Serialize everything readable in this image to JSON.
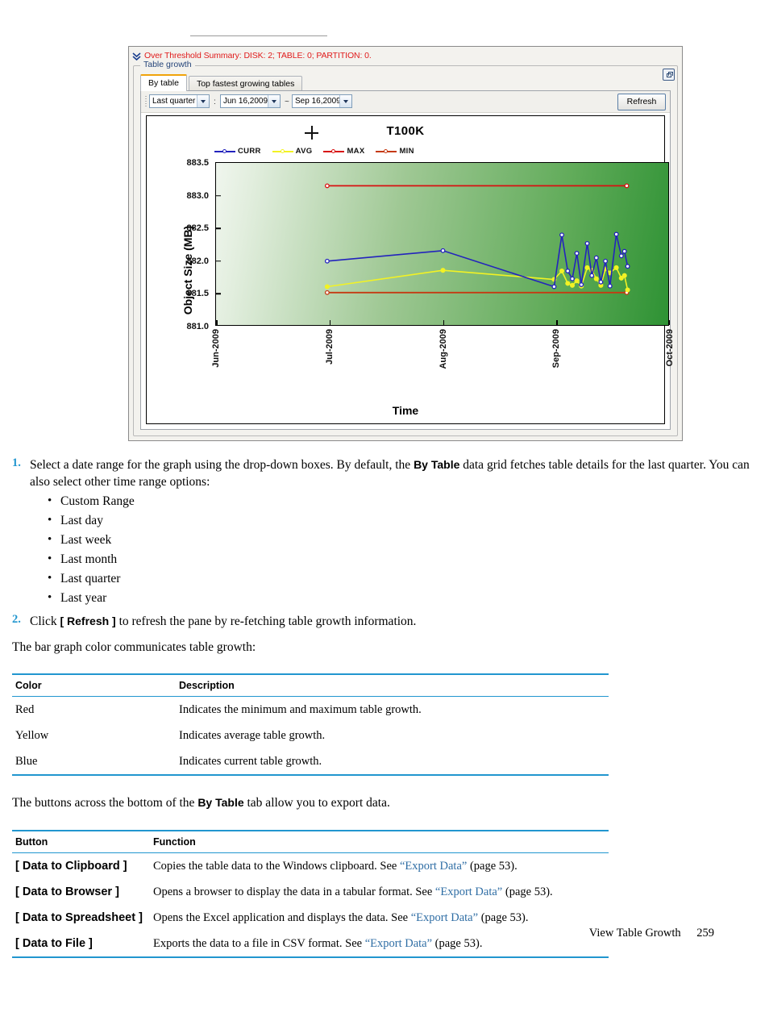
{
  "screenshot": {
    "threshold_summary": "Over Threshold Summary: DISK: 2; TABLE: 0; PARTITION: 0.",
    "group_title": "Table growth",
    "tabs": [
      {
        "label": "By table",
        "active": true
      },
      {
        "label": "Top fastest growing tables",
        "active": false
      }
    ],
    "toolbar": {
      "range_select": "Last quarter",
      "separator_colon": ":",
      "date_from": "Jun 16,2009",
      "separator_tilde": "~",
      "date_to": "Sep 16,2009",
      "refresh_label": "Refresh"
    }
  },
  "chart_data": {
    "type": "line",
    "title": "T100K",
    "xlabel": "Time",
    "ylabel": "Object Size (MB)",
    "ylim": [
      881.0,
      883.5
    ],
    "yticks": [
      "881.0",
      "881.5",
      "882.0",
      "882.5",
      "883.0",
      "883.5"
    ],
    "ytick_values": [
      881.0,
      881.5,
      882.0,
      882.5,
      883.0,
      883.5
    ],
    "xticks": [
      "Jun-2009",
      "Jul-2009",
      "Aug-2009",
      "Sep-2009",
      "Oct-2009"
    ],
    "xtick_positions": [
      0,
      0.25,
      0.5,
      0.75,
      1.0
    ],
    "grid": false,
    "legend_position": "top",
    "colors": {
      "curr": "#2323bd",
      "avg": "#f2f224",
      "max": "#d81111",
      "min": "#c53a12"
    },
    "series": [
      {
        "name": "CURR",
        "color": "#2323bd",
        "points": [
          [
            0.245,
            882.0
          ],
          [
            0.5,
            882.16
          ],
          [
            0.745,
            881.61
          ],
          [
            0.762,
            882.4
          ],
          [
            0.775,
            881.85
          ],
          [
            0.785,
            881.73
          ],
          [
            0.795,
            882.12
          ],
          [
            0.805,
            881.64
          ],
          [
            0.818,
            882.27
          ],
          [
            0.828,
            881.78
          ],
          [
            0.838,
            882.05
          ],
          [
            0.848,
            881.68
          ],
          [
            0.858,
            882.0
          ],
          [
            0.868,
            881.62
          ],
          [
            0.882,
            882.41
          ],
          [
            0.893,
            882.08
          ],
          [
            0.9,
            882.15
          ],
          [
            0.907,
            881.92
          ]
        ]
      },
      {
        "name": "AVG",
        "color": "#f2f224",
        "points": [
          [
            0.245,
            881.61
          ],
          [
            0.5,
            881.86
          ],
          [
            0.745,
            881.72
          ],
          [
            0.762,
            881.85
          ],
          [
            0.775,
            881.66
          ],
          [
            0.785,
            881.63
          ],
          [
            0.795,
            881.7
          ],
          [
            0.805,
            881.62
          ],
          [
            0.818,
            881.9
          ],
          [
            0.828,
            881.86
          ],
          [
            0.838,
            881.73
          ],
          [
            0.848,
            881.63
          ],
          [
            0.858,
            881.88
          ],
          [
            0.868,
            881.82
          ],
          [
            0.882,
            881.9
          ],
          [
            0.893,
            881.74
          ],
          [
            0.9,
            881.78
          ],
          [
            0.907,
            881.56
          ]
        ]
      },
      {
        "name": "MAX",
        "color": "#d81111",
        "points": [
          [
            0.245,
            883.15
          ],
          [
            0.905,
            883.15
          ]
        ]
      },
      {
        "name": "MIN",
        "color": "#c53a12",
        "points": [
          [
            0.245,
            881.52
          ],
          [
            0.905,
            881.52
          ]
        ]
      }
    ]
  },
  "doc": {
    "step1": {
      "num": "1.",
      "part1": "Select a date range for the graph using the drop-down boxes. By default, the ",
      "bold1": "By Table",
      "part2": " data grid fetches table details for the last quarter. You can also select other time range options:",
      "options": [
        "Custom Range",
        "Last day",
        "Last week",
        "Last month",
        "Last quarter",
        "Last year"
      ]
    },
    "step2": {
      "num": "2.",
      "part1": "Click ",
      "bold1": "[ Refresh ]",
      "part2": " to refresh the pane by re-fetching table growth information."
    },
    "intro_color": "The bar graph color communicates table growth:",
    "color_table": {
      "headers": [
        "Color",
        "Description"
      ],
      "rows": [
        [
          "Red",
          "Indicates the minimum and maximum table growth."
        ],
        [
          "Yellow",
          "Indicates average table growth."
        ],
        [
          "Blue",
          "Indicates current table growth."
        ]
      ]
    },
    "intro_buttons": {
      "part1": "The buttons across the bottom of the ",
      "bold1": "By Table",
      "part2": " tab allow you to export data."
    },
    "button_table": {
      "headers": [
        "Button",
        "Function"
      ],
      "rows": [
        {
          "button": "[ Data to Clipboard ]",
          "pre": "Copies the table data to the Windows clipboard. See ",
          "link": "“Export Data”",
          "post": " (page 53)."
        },
        {
          "button": "[ Data to Browser ]",
          "pre": "Opens a browser to display the data in a tabular format. See ",
          "link": "“Export Data”",
          "post": " (page 53)."
        },
        {
          "button": "[ Data to Spreadsheet ]",
          "pre": "Opens the Excel application and displays the data. See ",
          "link": "“Export Data”",
          "post": " (page 53)."
        },
        {
          "button": "[ Data to File ]",
          "pre": "Exports the data to a file in CSV format. See ",
          "link": "“Export Data”",
          "post": " (page 53)."
        }
      ]
    },
    "footer": {
      "chapter": "View Table Growth",
      "page": "259"
    }
  }
}
